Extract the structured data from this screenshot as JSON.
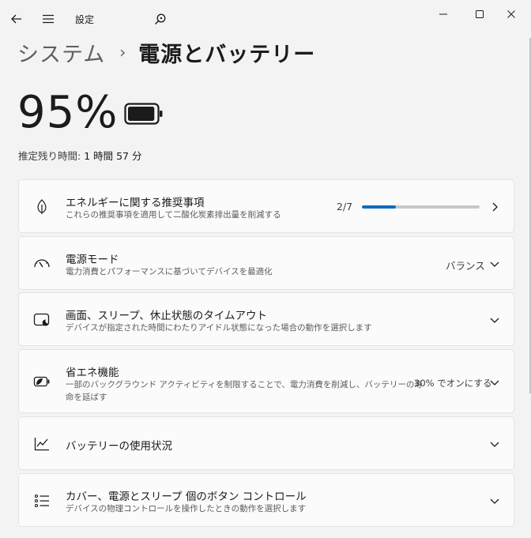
{
  "window": {
    "app_title": "設定",
    "icons": {
      "back": "back-arrow-icon",
      "menu": "hamburger-menu-icon",
      "search": "search-icon",
      "minimize": "minimize-icon",
      "maximize": "maximize-icon",
      "close": "close-icon"
    }
  },
  "breadcrumb": {
    "parent": "システム",
    "separator": "›",
    "current": "電源とバッテリー"
  },
  "battery": {
    "percent_text": "95%",
    "level": 0.95,
    "estimate_label": "推定残り時間:",
    "estimate_value": "1 時間 57 分",
    "icon": "battery-icon"
  },
  "cards": [
    {
      "id": "energy",
      "icon": "leaf-icon",
      "title": "エネルギーに関する推奨事項",
      "subtitle": "これらの推奨事項を適用して二酸化炭素排出量を削減する",
      "progress_text": "2/7",
      "progress": 0.2857,
      "chevron": "chevron-right-icon"
    },
    {
      "id": "power-mode",
      "icon": "gauge-icon",
      "title": "電源モード",
      "subtitle": "電力消費とパフォーマンスに基づいてデバイスを最適化",
      "value": "バランス",
      "chevron": "chevron-down-icon"
    },
    {
      "id": "timeout",
      "icon": "screen-sleep-icon",
      "title": "画面、スリープ、休止状態のタイムアウト",
      "subtitle": "デバイスが指定された時間にわたりアイドル状態になった場合の動作を選択します",
      "chevron": "chevron-down-icon"
    },
    {
      "id": "saver",
      "icon": "battery-saver-icon",
      "title": "省エネ機能",
      "subtitle_line1": "一部のバックグラウンド アクティビティを制限することで、電力消費を削減し、バッテリーの寿",
      "subtitle_line2": "命を延ばす",
      "value": "30% でオンにする",
      "chevron": "chevron-down-icon"
    },
    {
      "id": "usage",
      "icon": "chart-line-icon",
      "title": "バッテリーの使用状況",
      "chevron": "chevron-down-icon"
    },
    {
      "id": "buttons",
      "icon": "list-icon",
      "title": "カバー、電源とスリープ 個のボタン コントロール",
      "subtitle": "デバイスの物理コントロールを操作したときの動作を選択します",
      "chevron": "chevron-down-icon"
    }
  ],
  "colors": {
    "accent": "#0f6cbd",
    "background": "#f3f3f3",
    "card": "#fbfbfb"
  }
}
